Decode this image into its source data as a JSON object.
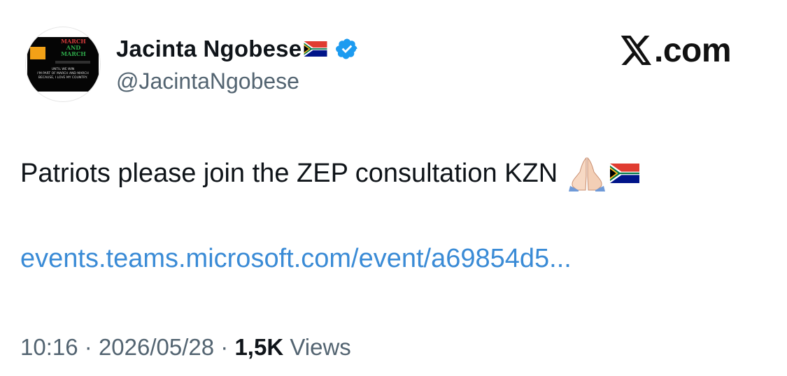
{
  "tweet": {
    "author_name": "Jacinta Ngobese",
    "handle": "@JacintaNgobese",
    "brand": ".com",
    "text": "Patriots please join the ZEP consultation KZN",
    "link": "events.teams.microsoft.com/event/a69854d5...",
    "time": "10:16",
    "date": "2026/05/28",
    "separator": "·",
    "views_count": "1,5K",
    "views_label": "Views"
  },
  "avatar": {
    "line1": "MARCH",
    "line2": "AND",
    "line3": "MARCH",
    "line4": "UNTIL WE WIN",
    "caption": "I'M PART OF MARCH AND MARCH BECAUSE, I LOVE MY COUNTRY."
  },
  "colors": {
    "link": "#3a8bd6",
    "verified": "#1d9bf0",
    "muted": "#536471"
  },
  "icons": [
    "south-africa-flag-icon",
    "verified-badge-icon",
    "x-logo-icon",
    "praying-hands-icon"
  ]
}
